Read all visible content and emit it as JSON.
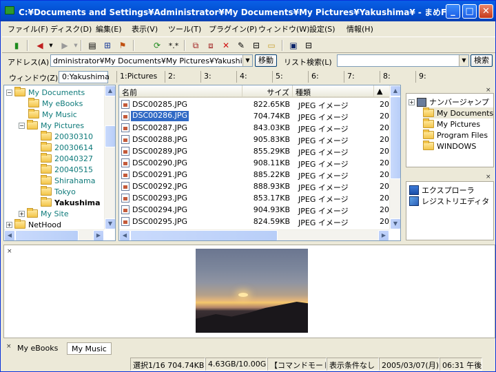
{
  "window": {
    "title": "C:¥Documents and Settings¥Administrator¥My Documents¥My Pictures¥Yakushima¥ - まめF..."
  },
  "menu": [
    "ファイル(F)",
    "ディスク(D)",
    "編集(E)",
    "表示(V)",
    "ツール(T)",
    "プラグイン(P)",
    "ウィンドウ(W)",
    "設定(S)",
    "情報(H)"
  ],
  "toolbar": {
    "wildcard_label": "*.*"
  },
  "address": {
    "label": "アドレス(A)",
    "value": "dministrator¥My Documents¥My Pictures¥Yakushima¥",
    "go_label": "移動",
    "list_search_label": "リスト検索(L)",
    "list_search_value": "",
    "search_button": "検索"
  },
  "tabs": {
    "label": "ウィンドウ(Z)",
    "items": [
      "0:Yakushima",
      "1:Pictures",
      "2:",
      "3:",
      "4:",
      "5:",
      "6:",
      "7:",
      "8:",
      "9:"
    ]
  },
  "tree": [
    {
      "label": "My Documents",
      "teal": true
    },
    {
      "label": "My eBooks",
      "teal": true
    },
    {
      "label": "My Music",
      "teal": true
    },
    {
      "label": "My Pictures",
      "teal": true
    },
    {
      "label": "20030310",
      "teal": true
    },
    {
      "label": "20030614",
      "teal": true
    },
    {
      "label": "20040327",
      "teal": true
    },
    {
      "label": "20040515",
      "teal": true
    },
    {
      "label": "Shirahama",
      "teal": true
    },
    {
      "label": "Tokyo",
      "teal": true
    },
    {
      "label": "Yakushima",
      "teal": false
    },
    {
      "label": "My Site",
      "teal": true
    },
    {
      "label": "NetHood",
      "teal": false
    }
  ],
  "filelist": {
    "headers": {
      "name": "名前",
      "size": "サイズ",
      "type": "種類",
      "date": ""
    },
    "rows": [
      {
        "name": "DSC00285.JPG",
        "size": "822.65KB",
        "type": "JPEG イメージ",
        "date": "20"
      },
      {
        "name": "DSC00286.JPG",
        "size": "704.74KB",
        "type": "JPEG イメージ",
        "date": "20"
      },
      {
        "name": "DSC00287.JPG",
        "size": "843.03KB",
        "type": "JPEG イメージ",
        "date": "20"
      },
      {
        "name": "DSC00288.JPG",
        "size": "905.83KB",
        "type": "JPEG イメージ",
        "date": "20"
      },
      {
        "name": "DSC00289.JPG",
        "size": "855.29KB",
        "type": "JPEG イメージ",
        "date": "20"
      },
      {
        "name": "DSC00290.JPG",
        "size": "908.11KB",
        "type": "JPEG イメージ",
        "date": "20"
      },
      {
        "name": "DSC00291.JPG",
        "size": "885.22KB",
        "type": "JPEG イメージ",
        "date": "20"
      },
      {
        "name": "DSC00292.JPG",
        "size": "888.93KB",
        "type": "JPEG イメージ",
        "date": "20"
      },
      {
        "name": "DSC00293.JPG",
        "size": "853.17KB",
        "type": "JPEG イメージ",
        "date": "20"
      },
      {
        "name": "DSC00294.JPG",
        "size": "904.93KB",
        "type": "JPEG イメージ",
        "date": "20"
      },
      {
        "name": "DSC00295.JPG",
        "size": "824.59KB",
        "type": "JPEG イメージ",
        "date": "20"
      }
    ],
    "selected_index": 1
  },
  "jump": {
    "items": [
      "ナンバージャンプ",
      "My Documents",
      "My Pictures",
      "Program Files",
      "WINDOWS"
    ]
  },
  "tools": {
    "items": [
      "エクスプローラ",
      "レジストリエディタ"
    ]
  },
  "bottom_tabs": [
    "My eBooks",
    "My Music"
  ],
  "status": {
    "selection": "選択1/16 704.74KB",
    "disk": "4.63GB/10.00GB",
    "mode": "【コマンドモード】",
    "filter": "表示条件なし",
    "date": "2005/03/07(月)",
    "time": "06:31 午後"
  }
}
